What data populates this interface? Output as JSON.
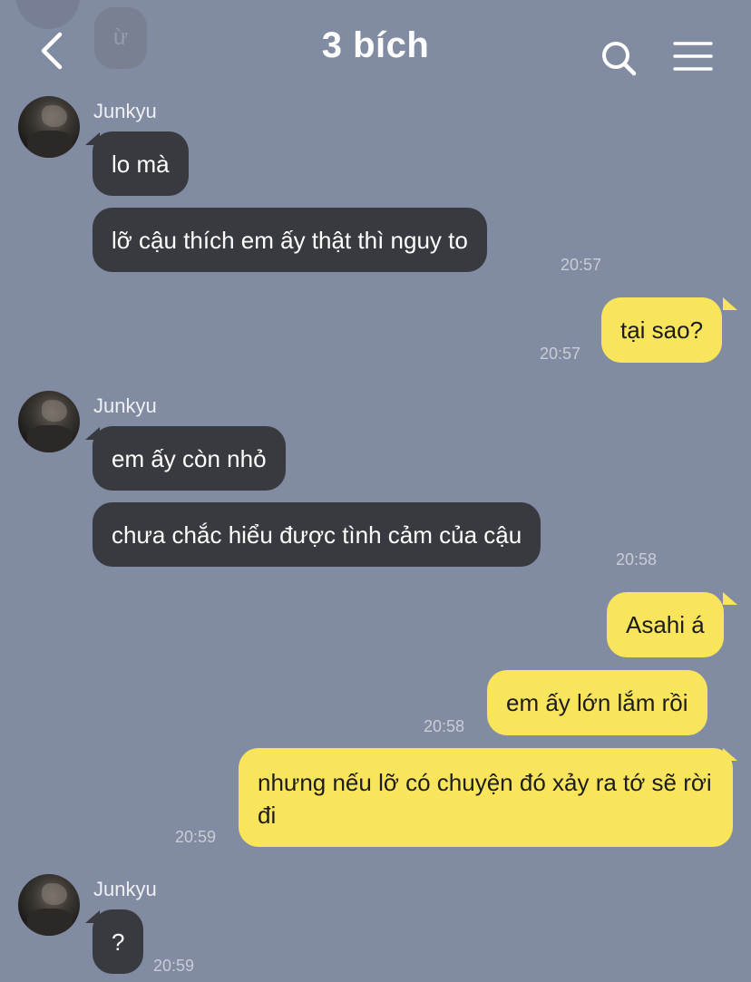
{
  "header": {
    "title": "3 bích",
    "ghost_text": "ừ"
  },
  "colors": {
    "background": "#818ba1",
    "incoming_bubble": "#383a3f",
    "outgoing_bubble": "#f9e55b"
  },
  "icons": [
    "back-arrow-icon",
    "search-icon",
    "menu-icon"
  ],
  "messages": {
    "g1": {
      "sender": "Junkyu",
      "m1": "lo mà",
      "m2": "lỡ cậu thích em ấy thật thì nguy to",
      "time": "20:57"
    },
    "o1": {
      "m1": "tại sao?",
      "time": "20:57"
    },
    "g2": {
      "sender": "Junkyu",
      "m1": "em ấy còn nhỏ",
      "m2": "chưa chắc hiểu được tình cảm của cậu",
      "time": "20:58"
    },
    "o2": {
      "m1": "Asahi á",
      "m2": "em ấy lớn lắm rồi",
      "time": "20:58"
    },
    "o3": {
      "m1": "nhưng nếu lỡ có chuyện đó xảy ra tớ sẽ rời đi",
      "time": "20:59"
    },
    "g3": {
      "sender": "Junkyu",
      "m1": "?",
      "time": "20:59"
    }
  }
}
